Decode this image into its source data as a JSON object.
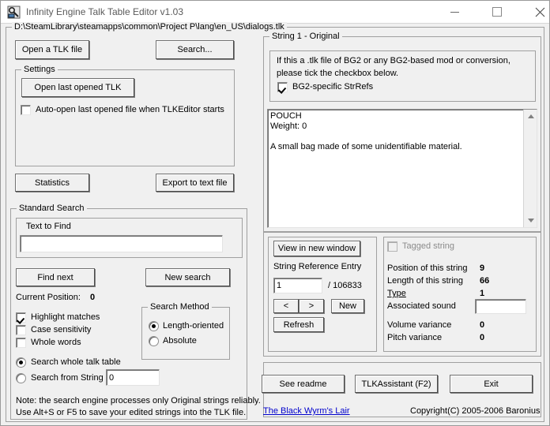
{
  "window": {
    "title": "Infinity Engine Talk Table Editor v1.03",
    "icon": "tlk-app-icon",
    "controls": {
      "minimize": "minimize-icon",
      "maximize": "maximize-icon",
      "close": "close-icon"
    }
  },
  "file_group": {
    "legend": "D:\\SteamLibrary\\steamapps\\common\\Project P\\lang\\en_US\\dialogs.tlk"
  },
  "left": {
    "open_tlk_button": "Open a TLK file",
    "search_button": "Search...",
    "settings": {
      "legend": "Settings",
      "open_last_button": "Open last opened TLK",
      "autoopen_checkbox": {
        "label": "Auto-open last opened file when TLKEditor starts",
        "checked": false
      }
    },
    "statistics_button": "Statistics",
    "export_button": "Export to text file",
    "standard_search": {
      "legend": "Standard Search",
      "text_to_find_label": "Text to Find",
      "text_to_find_value": "",
      "find_next_button": "Find next",
      "new_search_button": "New search",
      "current_position_label": "Current Position:",
      "current_position_value": "0",
      "options": [
        {
          "label": "Highlight matches",
          "checked": true
        },
        {
          "label": "Case sensitivity",
          "checked": false
        },
        {
          "label": "Whole words",
          "checked": false
        }
      ],
      "scope": [
        {
          "label": "Search whole talk table",
          "selected": true
        },
        {
          "label": "Search from String",
          "selected": false
        }
      ],
      "search_from_string_value": "0",
      "method": {
        "legend": "Search Method",
        "options": [
          {
            "label": "Length-oriented",
            "selected": true
          },
          {
            "label": "Absolute",
            "selected": false
          }
        ]
      },
      "note_line1": "Note: the search engine processes only Original strings reliably.",
      "note_line2": "Use Alt+S or F5 to save your edited strings into the TLK file."
    }
  },
  "right": {
    "string_group": {
      "legend": "String 1 - Original",
      "info_line1": "If this a .tlk file of BG2 or any BG2-based mod or conversion,",
      "info_line2": "please tick the checkbox below.",
      "bg2_checkbox": {
        "label": "BG2-specific StrRefs",
        "checked": true
      },
      "string_text": "POUCH\nWeight: 0\n\nA small bag made of some unidentifiable material."
    },
    "nav": {
      "view_new_window_button": "View in new window",
      "string_ref_label": "String Reference Entry",
      "string_ref_value": "1",
      "total_strings": "/ 106833",
      "prev_button": "<",
      "next_button": ">",
      "new_button": "New",
      "refresh_button": "Refresh"
    },
    "details": {
      "tagged_checkbox": {
        "label": "Tagged string",
        "checked": false,
        "disabled": true
      },
      "position_label": "Position of this string",
      "position_value": "9",
      "length_label": "Length of this string",
      "length_value": "66",
      "type_label": "Type",
      "type_value": "1",
      "assoc_sound_label": "Associated sound",
      "assoc_sound_value": "",
      "volume_label": "Volume variance",
      "volume_value": "0",
      "pitch_label": "Pitch variance",
      "pitch_value": "0"
    }
  },
  "footer": {
    "see_readme_button": "See readme",
    "tlkassistant_button": "TLKAssistant (F2)",
    "exit_button": "Exit",
    "site_link": "The Black Wyrm's Lair",
    "copyright": "Copyright(C) 2005-2006 Baronius"
  }
}
